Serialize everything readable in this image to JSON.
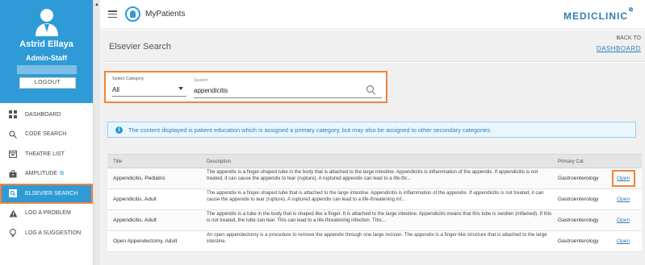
{
  "sidebar": {
    "user_name": "Astrid Ellaya",
    "user_role": "Admin-Staff",
    "logout_label": "LOGOUT",
    "items": [
      {
        "label": "DASHBOARD",
        "icon": "dashboard-grid-icon"
      },
      {
        "label": "CODE SEARCH",
        "icon": "search-icon"
      },
      {
        "label": "THEATRE LIST",
        "icon": "calendar-icon"
      },
      {
        "label": "AMPLITUDE",
        "icon": "briefcase-icon",
        "external": "⧉"
      },
      {
        "label": "ELSEVIER SEARCH",
        "icon": "search-box-icon",
        "active": true
      },
      {
        "label": "LOG A PROBLEM",
        "icon": "warning-triangle-icon"
      },
      {
        "label": "LOG A SUGGESTION",
        "icon": "lightbulb-icon"
      }
    ]
  },
  "header": {
    "app_title": "MyPatients",
    "brand": "MEDICLINIC"
  },
  "page": {
    "title": "Elsevier Search",
    "back_to": "BACK TO",
    "back_link": "DASHBOARD"
  },
  "search": {
    "category_label": "Select Category",
    "category_value": "All",
    "search_label": "Search",
    "search_value": "appendicitis"
  },
  "info": {
    "text": "The content displayed is patient education which is assigned a primary category, but may also be assigned to other secondary categories."
  },
  "table": {
    "columns": [
      "Title",
      "Description",
      "Primary Cat."
    ],
    "rows": [
      {
        "title": "Appendicitis, Pediatric",
        "description": "The appendix is a finger-shaped tube in the body that is attached to the large intestine. Appendicitis is inflammation of the appendix. If appendicitis is not treated, it can cause the appendix to tear (rupture). A ruptured appendix can lead to a life-thr...",
        "category": "Gastroenterology",
        "action": "Open"
      },
      {
        "title": "Appendicitis, Adult",
        "description": "The appendix is a finger-shaped tube that is attached to the large intestine. Appendicitis is inflammation of the appendix. If appendicitis is not treated, it can cause the appendix to tear (rupture). A ruptured appendix can lead to a life-threatening inf...",
        "category": "Gastroenterology",
        "action": "Open"
      },
      {
        "title": "Appendicitis, Adult",
        "description": "The appendix is a tube in the body that is shaped like a finger. It is attached to the large intestine. Appendicitis means that this tube is swollen (inflamed). If this is not treated, the tube can tear. This can lead to a life-threatening infection. This...",
        "category": "Gastroenterology",
        "action": "Open"
      },
      {
        "title": "Open Appendectomy, Adult",
        "description": "An open appendectomy is a procedure to remove the appendix through one large incision. The appendix is a finger-like structure that is attached to the large intestine.",
        "category": "Gastroenterology",
        "action": "Open"
      }
    ]
  }
}
